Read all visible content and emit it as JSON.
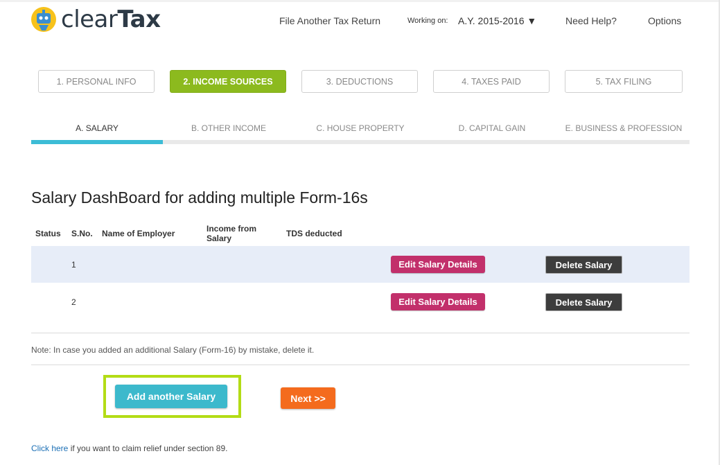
{
  "brand": {
    "name_light": "clear",
    "name_bold": "Tax",
    "logo_icon": "robot-mascot-icon",
    "colors": {
      "yellow": "#f7c21b",
      "blue": "#3cbcd6",
      "dark": "#2d3a46"
    }
  },
  "header": {
    "file_another": "File Another Tax Return",
    "working_on_label": "Working on:",
    "assessment_year": "A.Y. 2015-2016 ▼",
    "need_help": "Need Help?",
    "options": "Options"
  },
  "steps": [
    {
      "label": "1. PERSONAL INFO",
      "active": false
    },
    {
      "label": "2. INCOME SOURCES",
      "active": true
    },
    {
      "label": "3. DEDUCTIONS",
      "active": false
    },
    {
      "label": "4. TAXES PAID",
      "active": false
    },
    {
      "label": "5. TAX FILING",
      "active": false
    }
  ],
  "subtabs": [
    {
      "label": "A. SALARY",
      "active": true
    },
    {
      "label": "B. OTHER INCOME",
      "active": false
    },
    {
      "label": "C. HOUSE PROPERTY",
      "active": false
    },
    {
      "label": "D. CAPITAL GAIN",
      "active": false
    },
    {
      "label": "E. BUSINESS & PROFESSION",
      "active": false
    }
  ],
  "dashboard": {
    "title": "Salary DashBoard for adding multiple Form-16s",
    "columns": {
      "status": "Status",
      "sno": "S.No.",
      "employer": "Name of Employer",
      "income_line1": "Income from",
      "income_line2": "Salary",
      "tds": "TDS deducted"
    },
    "rows": [
      {
        "sno": "1",
        "edit_label": "Edit Salary Details",
        "delete_label": "Delete Salary"
      },
      {
        "sno": "2",
        "edit_label": "Edit Salary Details",
        "delete_label": "Delete Salary"
      }
    ],
    "note": "Note: In case you added an additional Salary (Form-16) by mistake, delete it."
  },
  "actions": {
    "add_salary": "Add another Salary",
    "next": "Next >>"
  },
  "footer": {
    "link_text": "Click here",
    "rest_text": " if you want to claim relief under section 89."
  }
}
